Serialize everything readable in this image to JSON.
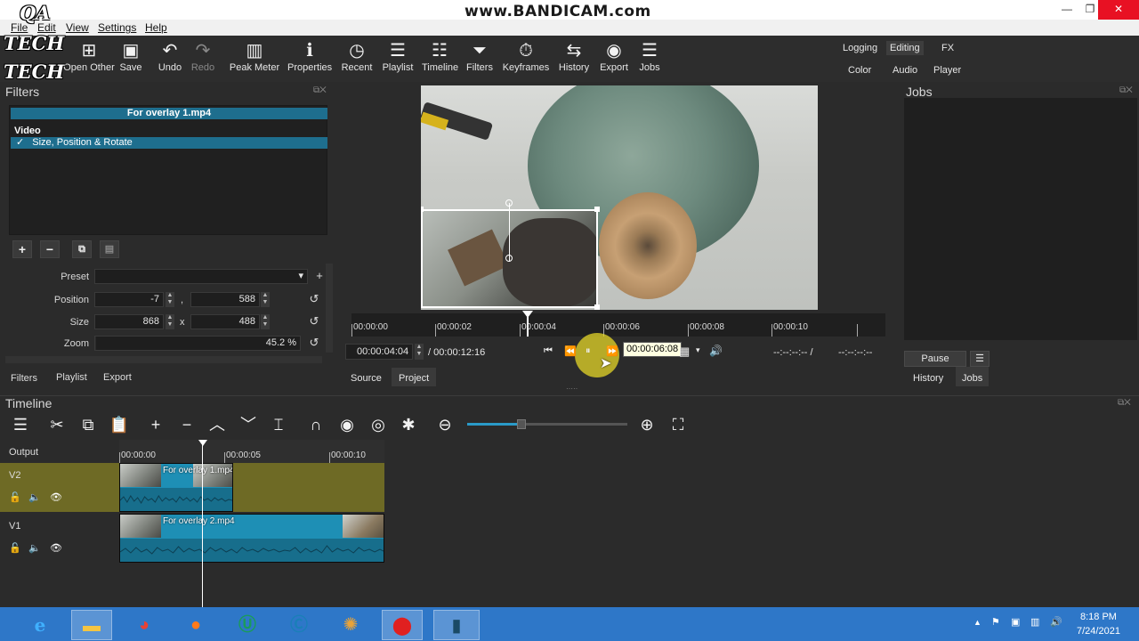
{
  "titlebar": {
    "watermark": "www.BANDICAM.com",
    "minimize": "—",
    "maximize": "❐",
    "close": "✕"
  },
  "watermark_logo": {
    "line1": "QA",
    "line2": "TECH",
    "line3": "TECH"
  },
  "menu": [
    "File",
    "Edit",
    "View",
    "Settings",
    "Help"
  ],
  "toolbar": {
    "items": [
      {
        "label": "Open Other",
        "icon": "open-other-icon",
        "glyph": "⊞"
      },
      {
        "label": "Save",
        "icon": "save-icon",
        "glyph": "💾"
      },
      {
        "label": "Undo",
        "icon": "undo-icon",
        "glyph": "↶"
      },
      {
        "label": "Redo",
        "icon": "redo-icon",
        "glyph": "↷"
      },
      {
        "label": "Peak Meter",
        "icon": "peak-meter-icon",
        "glyph": "▥"
      },
      {
        "label": "Properties",
        "icon": "properties-icon",
        "glyph": "ℹ"
      },
      {
        "label": "Recent",
        "icon": "recent-icon",
        "glyph": "◷"
      },
      {
        "label": "Playlist",
        "icon": "playlist-icon",
        "glyph": "☰"
      },
      {
        "label": "Timeline",
        "icon": "timeline-icon",
        "glyph": "☷"
      },
      {
        "label": "Filters",
        "icon": "filters-icon",
        "glyph": "⏷"
      },
      {
        "label": "Keyframes",
        "icon": "keyframes-icon",
        "glyph": "⏱"
      },
      {
        "label": "History",
        "icon": "history-icon",
        "glyph": "⇆"
      },
      {
        "label": "Export",
        "icon": "export-icon",
        "glyph": "◉"
      },
      {
        "label": "Jobs",
        "icon": "jobs-icon",
        "glyph": "☰"
      }
    ],
    "layouts": {
      "logging": "Logging",
      "editing": "Editing",
      "fx": "FX",
      "color": "Color",
      "audio": "Audio",
      "player": "Player"
    }
  },
  "filters_panel": {
    "title": "Filters",
    "clip_name": "For overlay 1.mp4",
    "group": "Video",
    "check": "✓",
    "filter_item": "Size, Position & Rotate",
    "preset_label": "Preset",
    "position_label": "Position",
    "position_x": "-7",
    "position_sep": ",",
    "position_y": "588",
    "size_label": "Size",
    "size_w": "868",
    "size_sep": "x",
    "size_h": "488",
    "zoom_label": "Zoom",
    "zoom_value": "45.2 %",
    "tabs": {
      "filters": "Filters",
      "playlist": "Playlist",
      "export": "Export"
    }
  },
  "player": {
    "ruler_ticks": [
      "00:00:00",
      "00:00:02",
      "00:00:04",
      "00:00:06",
      "00:00:08",
      "00:00:10"
    ],
    "current_time": "00:00:04:04",
    "duration": "/ 00:00:12:16",
    "tooltip": "00:00:06:08",
    "in_point": "--:--:--:-- /",
    "out_point": "--:--:--:--",
    "tabs": {
      "source": "Source",
      "project": "Project"
    }
  },
  "jobs_panel": {
    "title": "Jobs",
    "pause": "Pause",
    "tabs": {
      "history": "History",
      "jobs": "Jobs"
    }
  },
  "timeline": {
    "title": "Timeline",
    "output_label": "Output",
    "ruler_ticks": [
      "00:00:00",
      "00:00:05",
      "00:00:10"
    ],
    "tracks": [
      {
        "name": "V2",
        "clip": "For overlay 1.mp4"
      },
      {
        "name": "V1",
        "clip": "For overlay 2.mp4"
      }
    ]
  },
  "taskbar": {
    "time": "8:18 PM",
    "date": "7/24/2021"
  },
  "colors": {
    "accent": "#1e6e8e",
    "v2_track": "#6e6a25",
    "clip": "#1e8fb5",
    "taskbar": "#2e77c8"
  }
}
